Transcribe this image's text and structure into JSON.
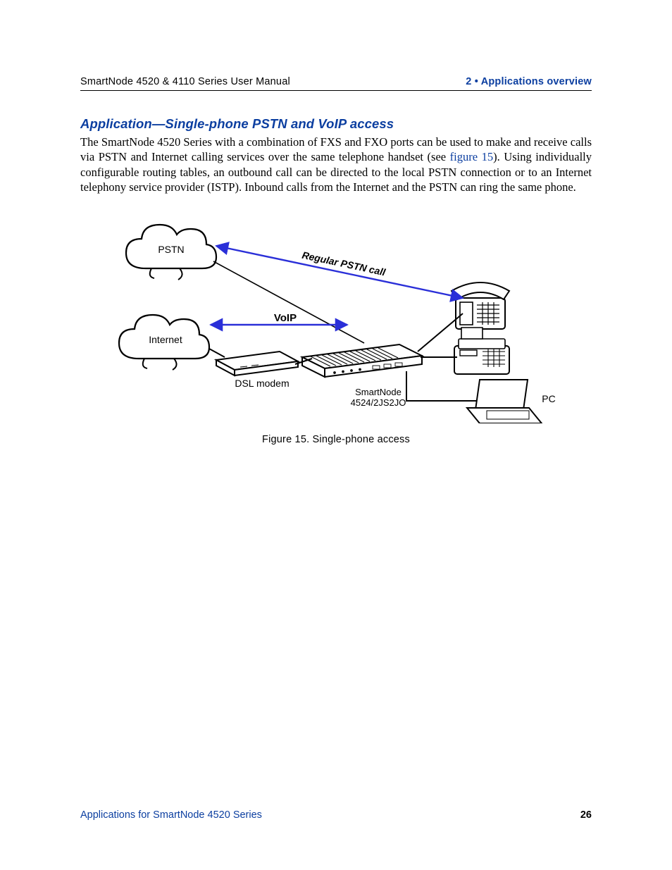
{
  "header": {
    "left": "SmartNode 4520 & 4110 Series User Manual",
    "right": "2 • Applications overview"
  },
  "section": {
    "title": "Application—Single-phone PSTN and VoIP access",
    "para_pre": "The SmartNode 4520 Series with a combination of FXS and FXO ports can be used to make and receive calls via PSTN and Internet calling services over the same telephone handset (see ",
    "para_link": "figure 15",
    "para_post": "). Using individually configurable routing tables, an outbound call can be directed to the local PSTN connection or to an Internet telephony service provider (ISTP). Inbound calls from the Internet and the PSTN can ring the same phone."
  },
  "figure": {
    "caption": "Figure 15. Single-phone access",
    "labels": {
      "pstn": "PSTN",
      "internet": "Internet",
      "voip": "VoIP",
      "regular_call": "Regular PSTN call",
      "dsl_modem": "DSL modem",
      "node_line1": "SmartNode",
      "node_line2": "4524/2JS2JO",
      "pc": "PC"
    }
  },
  "footer": {
    "left": "Applications for SmartNode 4520 Series",
    "page": "26"
  }
}
